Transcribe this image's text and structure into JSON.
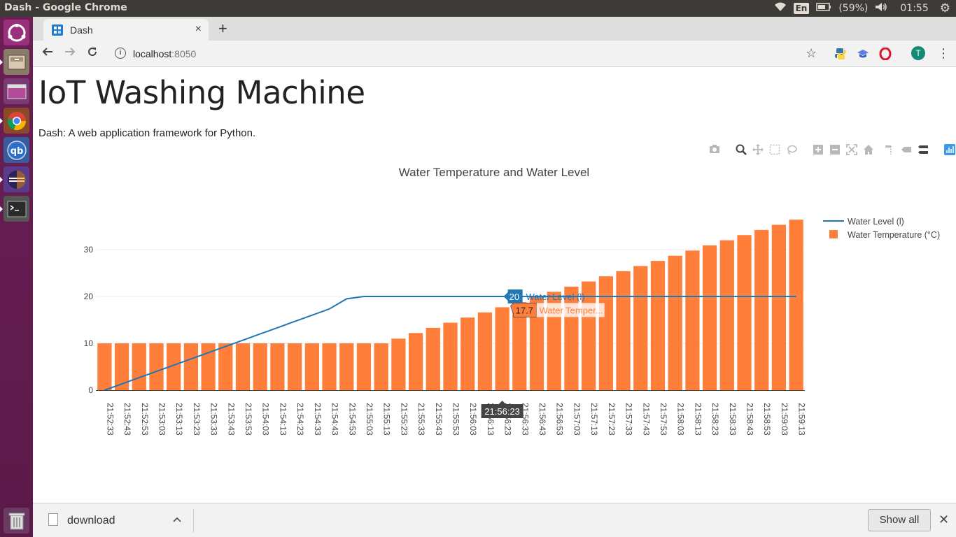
{
  "os": {
    "window_title": "Dash - Google Chrome",
    "tray": {
      "language": "En",
      "battery": "(59%)",
      "clock": "01:55"
    }
  },
  "browser": {
    "tab": {
      "label": "Dash",
      "close": "×"
    },
    "new_tab": "+",
    "url_host": "localhost",
    "url_port": ":8050",
    "avatar_initial": "T"
  },
  "page": {
    "heading": "IoT Washing Machine",
    "subtitle": "Dash: A web application framework for Python."
  },
  "chart_data": {
    "type": "bar",
    "title": "Water Temperature and Water Level",
    "xlabel": "",
    "ylabel": "",
    "ylim": [
      0,
      38
    ],
    "yticks": [
      0,
      10,
      20,
      30
    ],
    "grid": true,
    "legend_position": "top-right",
    "categories": [
      "21:52:33",
      "21:52:43",
      "21:52:53",
      "21:53:03",
      "21:53:13",
      "21:53:23",
      "21:53:33",
      "21:53:43",
      "21:53:53",
      "21:54:03",
      "21:54:13",
      "21:54:23",
      "21:54:33",
      "21:54:43",
      "21:54:53",
      "21:55:03",
      "21:55:13",
      "21:55:23",
      "21:55:33",
      "21:55:43",
      "21:55:53",
      "21:56:03",
      "21:56:13",
      "21:56:23",
      "21:56:33",
      "21:56:43",
      "21:56:53",
      "21:57:03",
      "21:57:13",
      "21:57:23",
      "21:57:33",
      "21:57:43",
      "21:57:53",
      "21:58:03",
      "21:58:13",
      "21:58:23",
      "21:58:33",
      "21:58:43",
      "21:58:53",
      "21:59:03",
      "21:59:13"
    ],
    "series": [
      {
        "name": "Water Level (l)",
        "kind": "line",
        "color": "#1f77b4",
        "values": [
          0,
          1.33,
          2.67,
          4,
          5.33,
          6.67,
          8,
          9.33,
          10.67,
          12,
          13.33,
          14.67,
          16,
          17.33,
          19.5,
          20,
          20,
          20,
          20,
          20,
          20,
          20,
          20,
          20,
          20,
          20,
          20,
          20,
          20,
          20,
          20,
          20,
          20,
          20,
          20,
          20,
          20,
          20,
          20,
          20,
          20
        ]
      },
      {
        "name": "Water Temperature (°C)",
        "kind": "bar",
        "color": "#ff7f3a",
        "values": [
          10,
          10,
          10,
          10,
          10,
          10,
          10,
          10,
          10,
          10,
          10,
          10,
          10,
          10,
          10,
          10,
          10,
          11,
          12.2,
          13.3,
          14.4,
          15.5,
          16.6,
          17.7,
          18.8,
          19.9,
          21,
          22.1,
          23.2,
          24.3,
          25.4,
          26.5,
          27.6,
          28.7,
          29.8,
          30.9,
          32,
          33.1,
          34.2,
          35.3,
          36.4
        ]
      }
    ],
    "hover": {
      "x_label": "21:56:23",
      "level_value": "20",
      "level_name": "Water Level (l)",
      "temp_value": "17.7",
      "temp_name": "Water Temper..."
    }
  },
  "download_bar": {
    "filename": "download",
    "show_all": "Show all"
  }
}
